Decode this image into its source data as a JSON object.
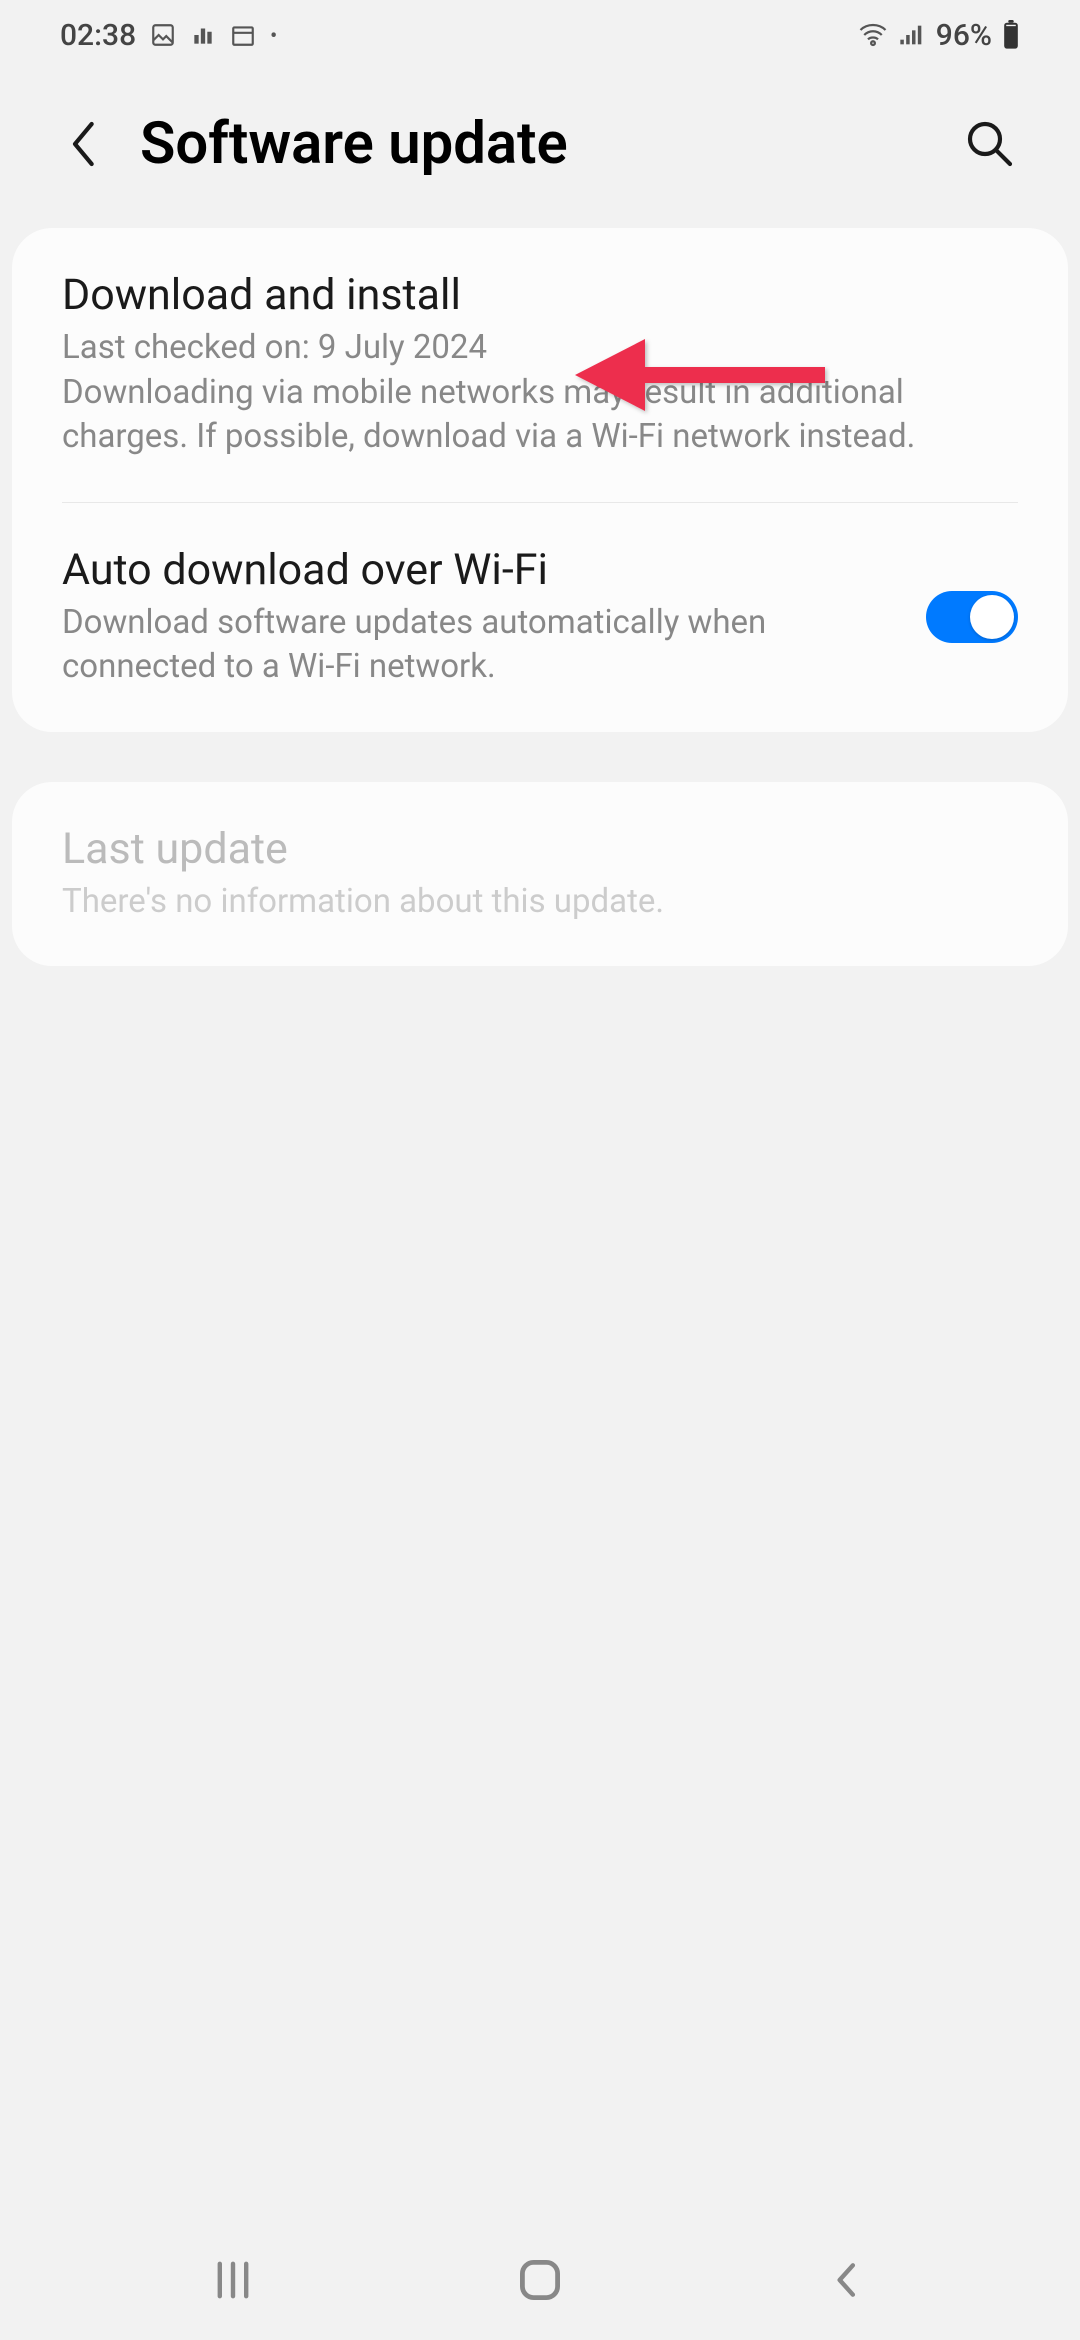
{
  "status_bar": {
    "time": "02:38",
    "battery_percent": "96%"
  },
  "header": {
    "title": "Software update"
  },
  "items": {
    "download_install": {
      "title": "Download and install",
      "subtitle": "Last checked on: 9 July 2024\nDownloading via mobile networks may result in additional charges. If possible, download via a Wi-Fi network instead."
    },
    "auto_download": {
      "title": "Auto download over Wi-Fi",
      "subtitle": "Download software updates automatically when connected to a Wi-Fi network.",
      "toggle_on": true
    },
    "last_update": {
      "title": "Last update",
      "subtitle": "There's no information about this update."
    }
  },
  "colors": {
    "accent": "#007aff",
    "annotation": "#ed2e4d"
  }
}
